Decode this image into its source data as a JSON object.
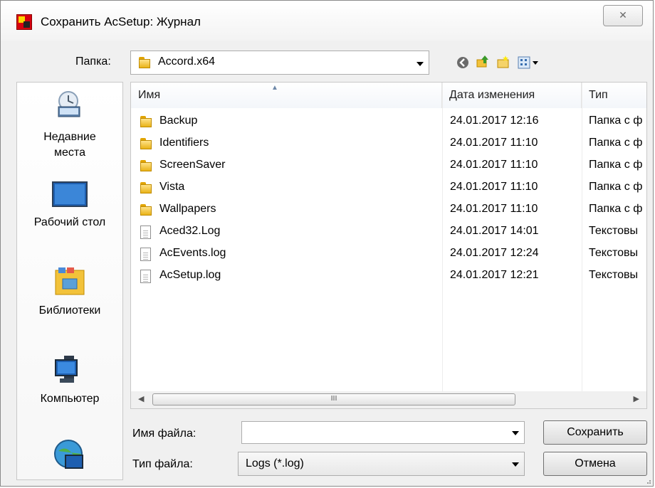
{
  "window": {
    "title": "Сохранить AcSetup: Журнал",
    "close_symbol": "✕"
  },
  "lookin": {
    "label": "Папка:",
    "value": "Accord.x64"
  },
  "places": [
    {
      "label": "Недавние\nместа",
      "icon": "recent-places-icon"
    },
    {
      "label": "Рабочий стол",
      "icon": "desktop-icon"
    },
    {
      "label": "Библиотеки",
      "icon": "libraries-icon"
    },
    {
      "label": "Компьютер",
      "icon": "computer-icon"
    }
  ],
  "columns": {
    "name": "Имя",
    "date": "Дата изменения",
    "type": "Тип"
  },
  "files": [
    {
      "name": "Backup",
      "date": "24.01.2017 12:16",
      "type": "Папка с ф",
      "icon": "folder-icon"
    },
    {
      "name": "Identifiers",
      "date": "24.01.2017 11:10",
      "type": "Папка с ф",
      "icon": "folder-icon"
    },
    {
      "name": "ScreenSaver",
      "date": "24.01.2017 11:10",
      "type": "Папка с ф",
      "icon": "folder-icon"
    },
    {
      "name": "Vista",
      "date": "24.01.2017 11:10",
      "type": "Папка с ф",
      "icon": "folder-icon"
    },
    {
      "name": "Wallpapers",
      "date": "24.01.2017 11:10",
      "type": "Папка с ф",
      "icon": "folder-icon"
    },
    {
      "name": "Aced32.Log",
      "date": "24.01.2017 14:01",
      "type": "Текстовы",
      "icon": "text-file-icon"
    },
    {
      "name": "AcEvents.log",
      "date": "24.01.2017 12:24",
      "type": "Текстовы",
      "icon": "text-file-icon"
    },
    {
      "name": "AcSetup.log",
      "date": "24.01.2017 12:21",
      "type": "Текстовы",
      "icon": "text-file-icon"
    }
  ],
  "filename": {
    "label": "Имя файла:",
    "value": ""
  },
  "filetype": {
    "label": "Тип файла:",
    "value": "Logs (*.log)"
  },
  "buttons": {
    "save": "Сохранить",
    "cancel": "Отмена"
  },
  "scroll": {
    "thumb_grip": "III"
  }
}
